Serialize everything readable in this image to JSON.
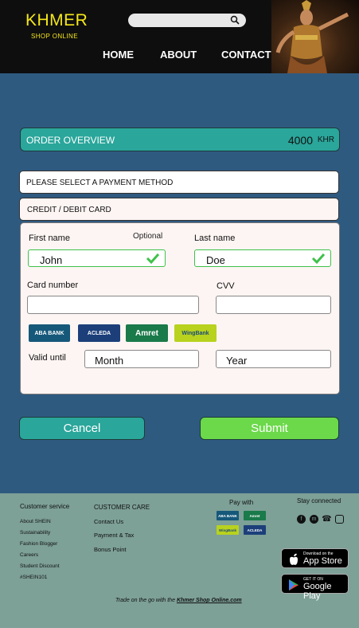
{
  "header": {
    "logo_title": "KHMER",
    "logo_subtitle": "SHOP ONLINE",
    "search_placeholder": "",
    "nav": {
      "home": "HOME",
      "about": "ABOUT",
      "contact": "CONTACT"
    }
  },
  "order": {
    "overview_label": "ORDER OVERVIEW",
    "amount": "4000",
    "currency": "KHR"
  },
  "payment": {
    "select_label": "PLEASE SELECT A PAYMENT METHOD",
    "method": "CREDIT / DEBIT CARD",
    "first_name_label": "First name",
    "optional_label": "Optional",
    "first_name_value": "John",
    "last_name_label": "Last name",
    "last_name_value": "Doe",
    "card_number_label": "Card number",
    "cvv_label": "CVV",
    "valid_until_label": "Valid until",
    "month_value": "Month",
    "year_value": "Year",
    "banks": [
      "ABA BANK",
      "ACLEDA",
      "Amret",
      "WingBank"
    ]
  },
  "actions": {
    "cancel": "Cancel",
    "submit": "Submit"
  },
  "footer": {
    "customer_service_head": "Customer service",
    "customer_service_items": [
      "About SHEIN",
      "Sustainability",
      "Fashion Blogger",
      "Careers",
      "Student Discount",
      "#SHEIN101"
    ],
    "customer_care_head": "CUSTOMER CARE",
    "customer_care_items": [
      "Contact Us",
      "Payment & Tax",
      "Bonus Point"
    ],
    "pay_with_head": "Pay with",
    "stay_connected_head": "Stay connected",
    "app_store_small": "Download on the",
    "app_store_big": "App Store",
    "google_play_small": "GET IT ON",
    "google_play_big": "Google Play",
    "tagline_prefix": "Trade on the go with the",
    "tagline_brand": "Khmer Shop Online.com"
  },
  "colors": {
    "accent": "#2aa69b",
    "submit": "#6bd94a",
    "background": "#2f5a80",
    "footer": "#7da097",
    "logo": "#f4e61a"
  },
  "icons": [
    "search-icon",
    "check-icon",
    "facebook-icon",
    "messenger-icon",
    "viber-icon",
    "instagram-icon",
    "apple-icon",
    "google-play-icon"
  ]
}
